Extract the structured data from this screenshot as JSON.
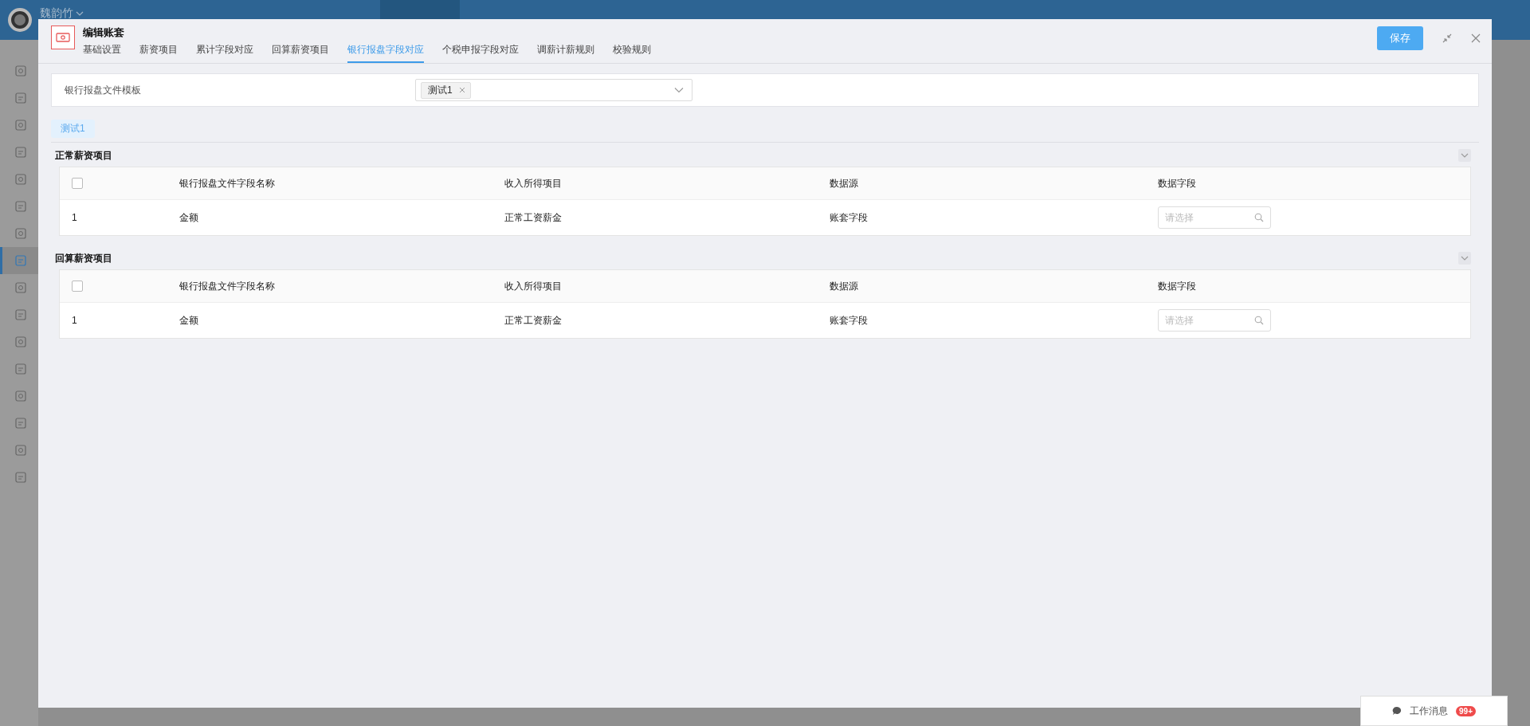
{
  "top_bar": {
    "user": "魏韵竹"
  },
  "sidebar": {
    "items": [
      {
        "selected": false
      },
      {
        "selected": false
      },
      {
        "selected": false
      },
      {
        "selected": false
      },
      {
        "selected": false
      },
      {
        "selected": false
      },
      {
        "selected": false
      },
      {
        "selected": true
      },
      {
        "selected": false
      },
      {
        "selected": false
      },
      {
        "selected": false
      },
      {
        "selected": false
      },
      {
        "selected": false
      },
      {
        "selected": false
      },
      {
        "selected": false
      },
      {
        "selected": false
      }
    ]
  },
  "modal": {
    "title": "编辑账套",
    "tabs": [
      {
        "label": "基础设置",
        "selected": false
      },
      {
        "label": "薪资项目",
        "selected": false
      },
      {
        "label": "累计字段对应",
        "selected": false
      },
      {
        "label": "回算薪资项目",
        "selected": false
      },
      {
        "label": "银行报盘字段对应",
        "selected": true
      },
      {
        "label": "个税申报字段对应",
        "selected": false
      },
      {
        "label": "调薪计薪规则",
        "selected": false
      },
      {
        "label": "校验规则",
        "selected": false
      }
    ],
    "save_button": "保存",
    "template_field": {
      "label": "银行报盘文件模板",
      "tags": [
        "测试1"
      ]
    },
    "template_tabs": [
      {
        "label": "测试1",
        "selected": true
      }
    ],
    "sections": [
      {
        "title": "正常薪资项目",
        "expanded": true,
        "header_checked": false,
        "columns": [
          "银行报盘文件字段名称",
          "收入所得项目",
          "数据源",
          "数据字段"
        ],
        "rows": [
          {
            "index": "1",
            "name": "金额",
            "income_item": "正常工资薪金",
            "source": "账套字段",
            "field_placeholder": "请选择"
          }
        ]
      },
      {
        "title": "回算薪资项目",
        "expanded": true,
        "header_checked": false,
        "columns": [
          "银行报盘文件字段名称",
          "收入所得项目",
          "数据源",
          "数据字段"
        ],
        "rows": [
          {
            "index": "1",
            "name": "金额",
            "income_item": "正常工资薪金",
            "source": "账套字段",
            "field_placeholder": "请选择"
          }
        ]
      }
    ]
  },
  "messages": {
    "label": "工作消息",
    "badge": "99+"
  }
}
